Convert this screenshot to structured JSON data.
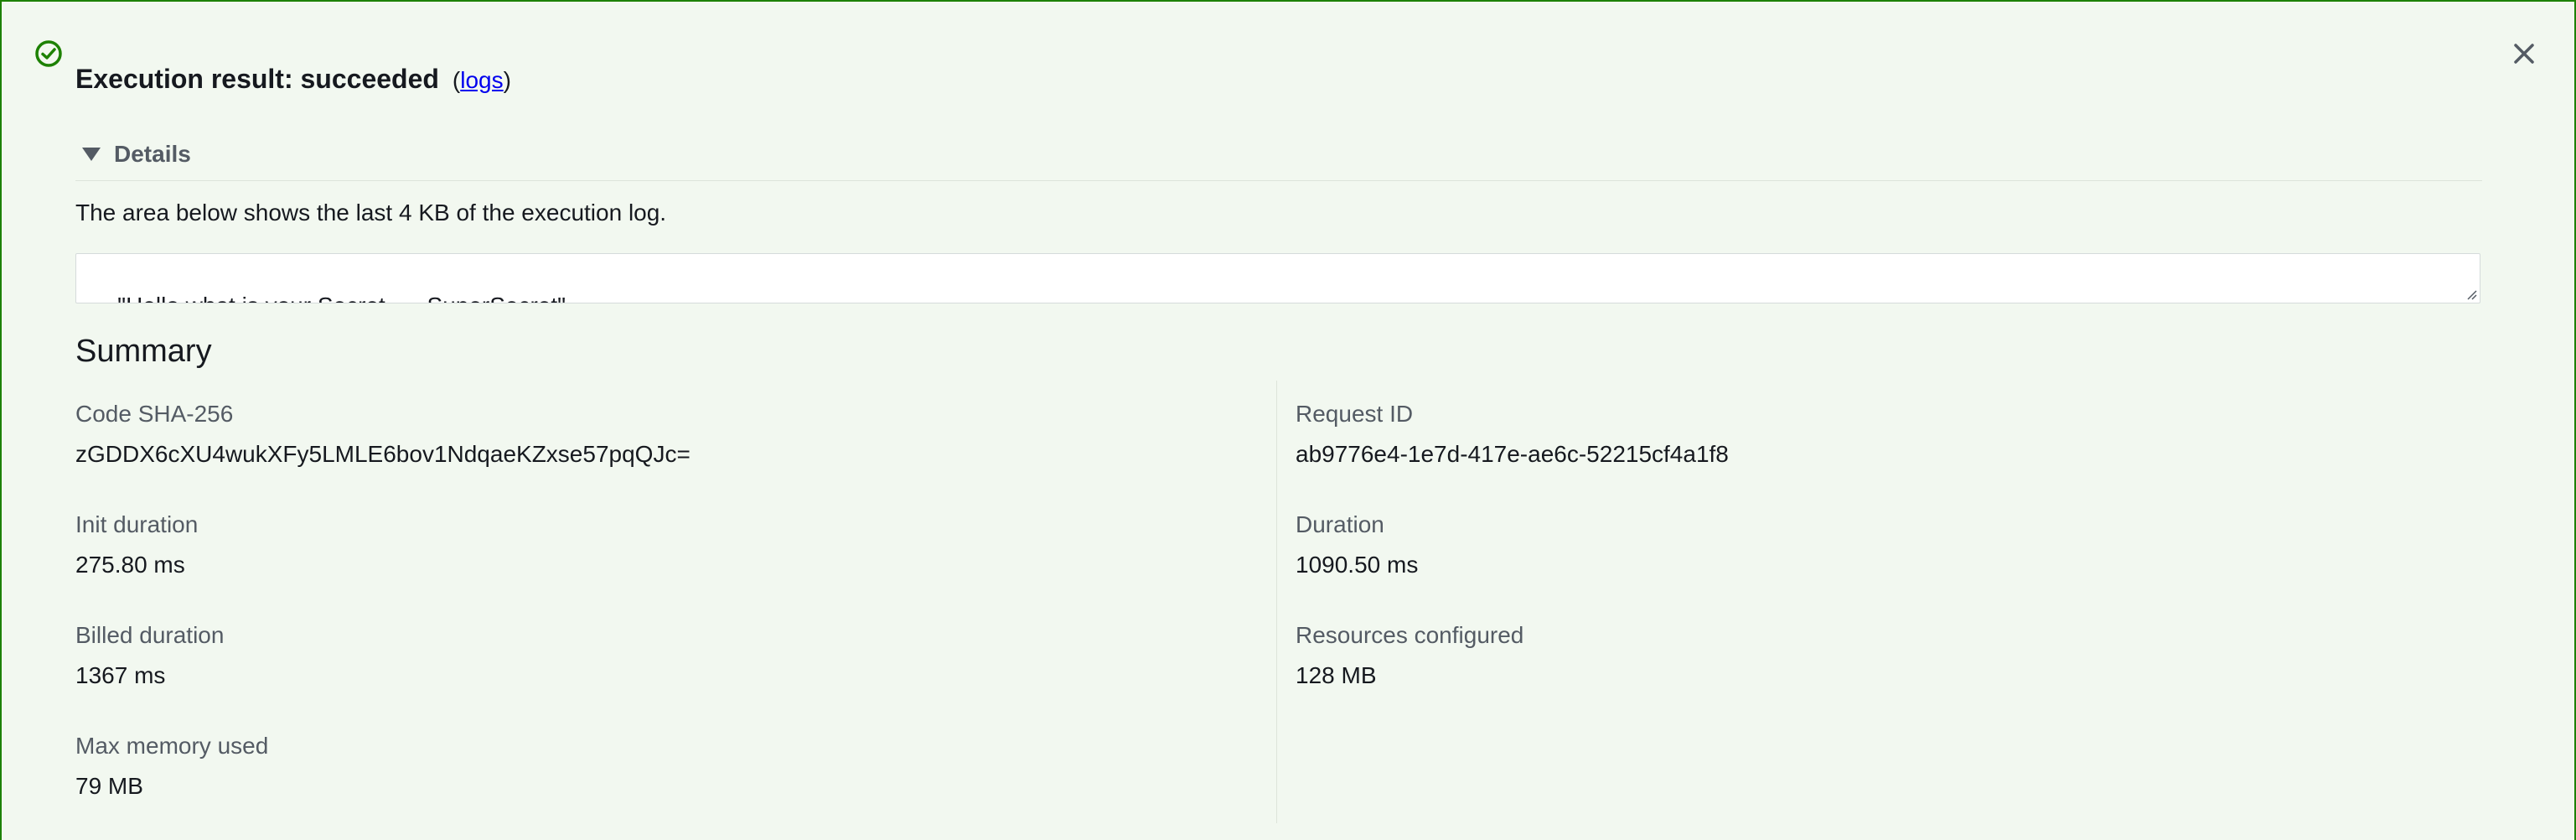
{
  "header": {
    "status_icon": "check-circle-icon",
    "title": "Execution result: succeeded",
    "logs_open": "(",
    "logs_label": "logs",
    "logs_close": ")",
    "close_icon": "close-icon"
  },
  "details": {
    "label": "Details",
    "expanded": true,
    "description": "The area below shows the last 4 KB of the execution log.",
    "log_output": "\"Hello what is your Secret -  - SuperSecret\""
  },
  "summary": {
    "title": "Summary",
    "fields": {
      "code_sha256": {
        "label": "Code SHA-256",
        "value": "zGDDX6cXU4wukXFy5LMLE6bov1NdqaeKZxse57pqQJc="
      },
      "request_id": {
        "label": "Request ID",
        "value": "ab9776e4-1e7d-417e-ae6c-52215cf4a1f8"
      },
      "init_duration": {
        "label": "Init duration",
        "value": "275.80 ms"
      },
      "duration": {
        "label": "Duration",
        "value": "1090.50 ms"
      },
      "billed_duration": {
        "label": "Billed duration",
        "value": "1367 ms"
      },
      "resources_configured": {
        "label": "Resources configured",
        "value": "128 MB"
      },
      "max_memory_used": {
        "label": "Max memory used",
        "value": "79 MB"
      }
    }
  },
  "colors": {
    "success": "#1d8102",
    "background": "#f2f8f0",
    "link": "#0000ee",
    "label_gray": "#545b64"
  }
}
